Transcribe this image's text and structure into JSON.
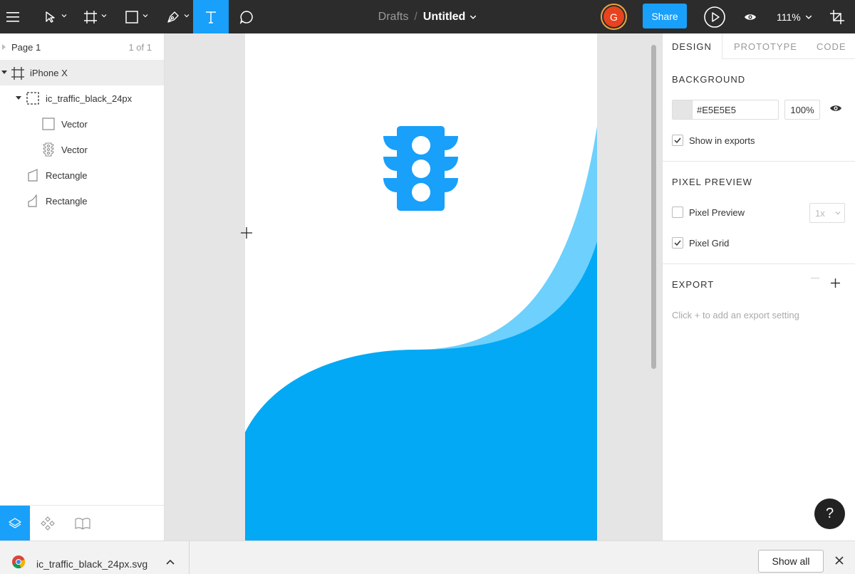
{
  "toolbar": {
    "breadcrumb_parent": "Drafts",
    "breadcrumb_separator": "/",
    "file_title": "Untitled",
    "avatar_initial": "G",
    "share_label": "Share",
    "zoom_label": "111%"
  },
  "pages": {
    "name": "Page 1",
    "count": "1 of 1"
  },
  "layers": [
    {
      "label": "iPhone X",
      "kind": "frame"
    },
    {
      "label": "ic_traffic_black_24px",
      "kind": "group"
    },
    {
      "label": "Vector",
      "kind": "vector"
    },
    {
      "label": "Vector",
      "kind": "vector-traffic"
    },
    {
      "label": "Rectangle",
      "kind": "rect"
    },
    {
      "label": "Rectangle",
      "kind": "rect"
    }
  ],
  "right_panel": {
    "tabs": [
      "DESIGN",
      "PROTOTYPE",
      "CODE"
    ],
    "background": {
      "title": "BACKGROUND",
      "hex": "#E5E5E5",
      "opacity": "100%",
      "show_in_exports_label": "Show in exports",
      "show_in_exports_checked": true
    },
    "pixel_preview": {
      "title": "PIXEL PREVIEW",
      "pixel_preview_label": "Pixel Preview",
      "pixel_preview_checked": false,
      "scale_value": "1x",
      "pixel_grid_label": "Pixel Grid",
      "pixel_grid_checked": true
    },
    "export": {
      "title": "EXPORT",
      "hint": "Click + to add an export setting"
    },
    "help_label": "?"
  },
  "download_bar": {
    "file_name": "ic_traffic_black_24px.svg",
    "show_all_label": "Show all"
  },
  "colors": {
    "accent": "#18a0fb",
    "shape_dark": "#03a9f4",
    "shape_light": "#6ed0fc",
    "toolbar_bg": "#2c2c2c"
  }
}
